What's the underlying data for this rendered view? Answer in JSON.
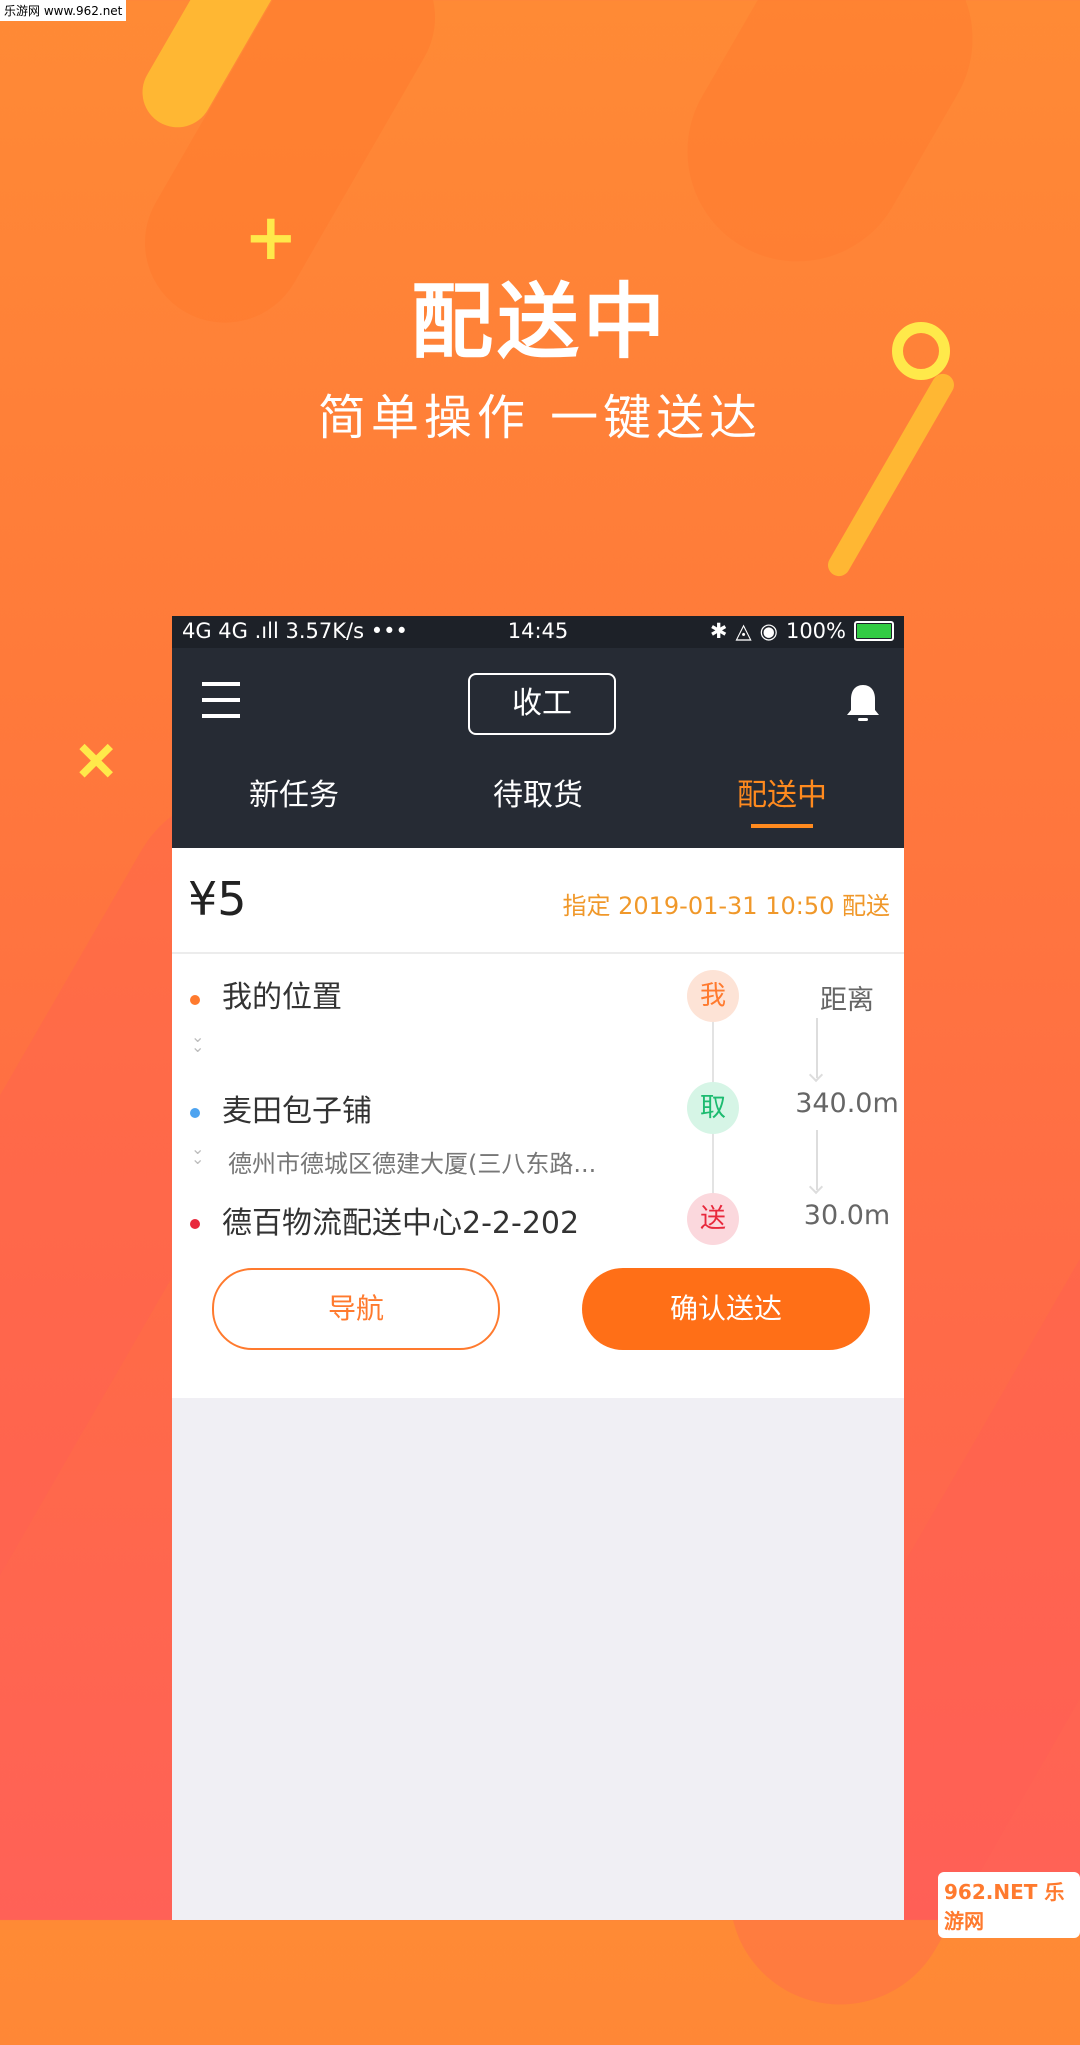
{
  "watermark": "乐游网 www.962.net",
  "hero": {
    "title": "配送中",
    "subtitle": "简单操作 一键送达"
  },
  "status_bar": {
    "network": "4G 4G .ıll 3.57K/s •••",
    "time": "14:45",
    "battery": "100%",
    "battery_level": 1.0
  },
  "app_bar": {
    "clock_out_label": "收工"
  },
  "tabs": [
    {
      "label": "新任务"
    },
    {
      "label": "待取货"
    },
    {
      "label": "配送中"
    }
  ],
  "active_tab": "配送中",
  "order": {
    "price": "¥5",
    "schedule": "指定 2019-01-31 10:50 配送",
    "route": {
      "me": {
        "label": "我的位置",
        "badge": "我",
        "dist_header": "距离"
      },
      "pickup": {
        "label": "麦田包子铺",
        "badge": "取",
        "distance": "340.0m",
        "address": "德州市德城区德建大厦(三八东路..."
      },
      "delivery": {
        "label": "德百物流配送中心2-2-202",
        "badge": "送",
        "distance": "30.0m"
      }
    },
    "buttons": {
      "navigate": "导航",
      "confirm": "确认送达"
    }
  },
  "corner_logo": "962.NET 乐游网",
  "colors": {
    "accent": "#ff8a1e",
    "confirm_button": "#ff6f17",
    "app_bar": "#262b34"
  }
}
